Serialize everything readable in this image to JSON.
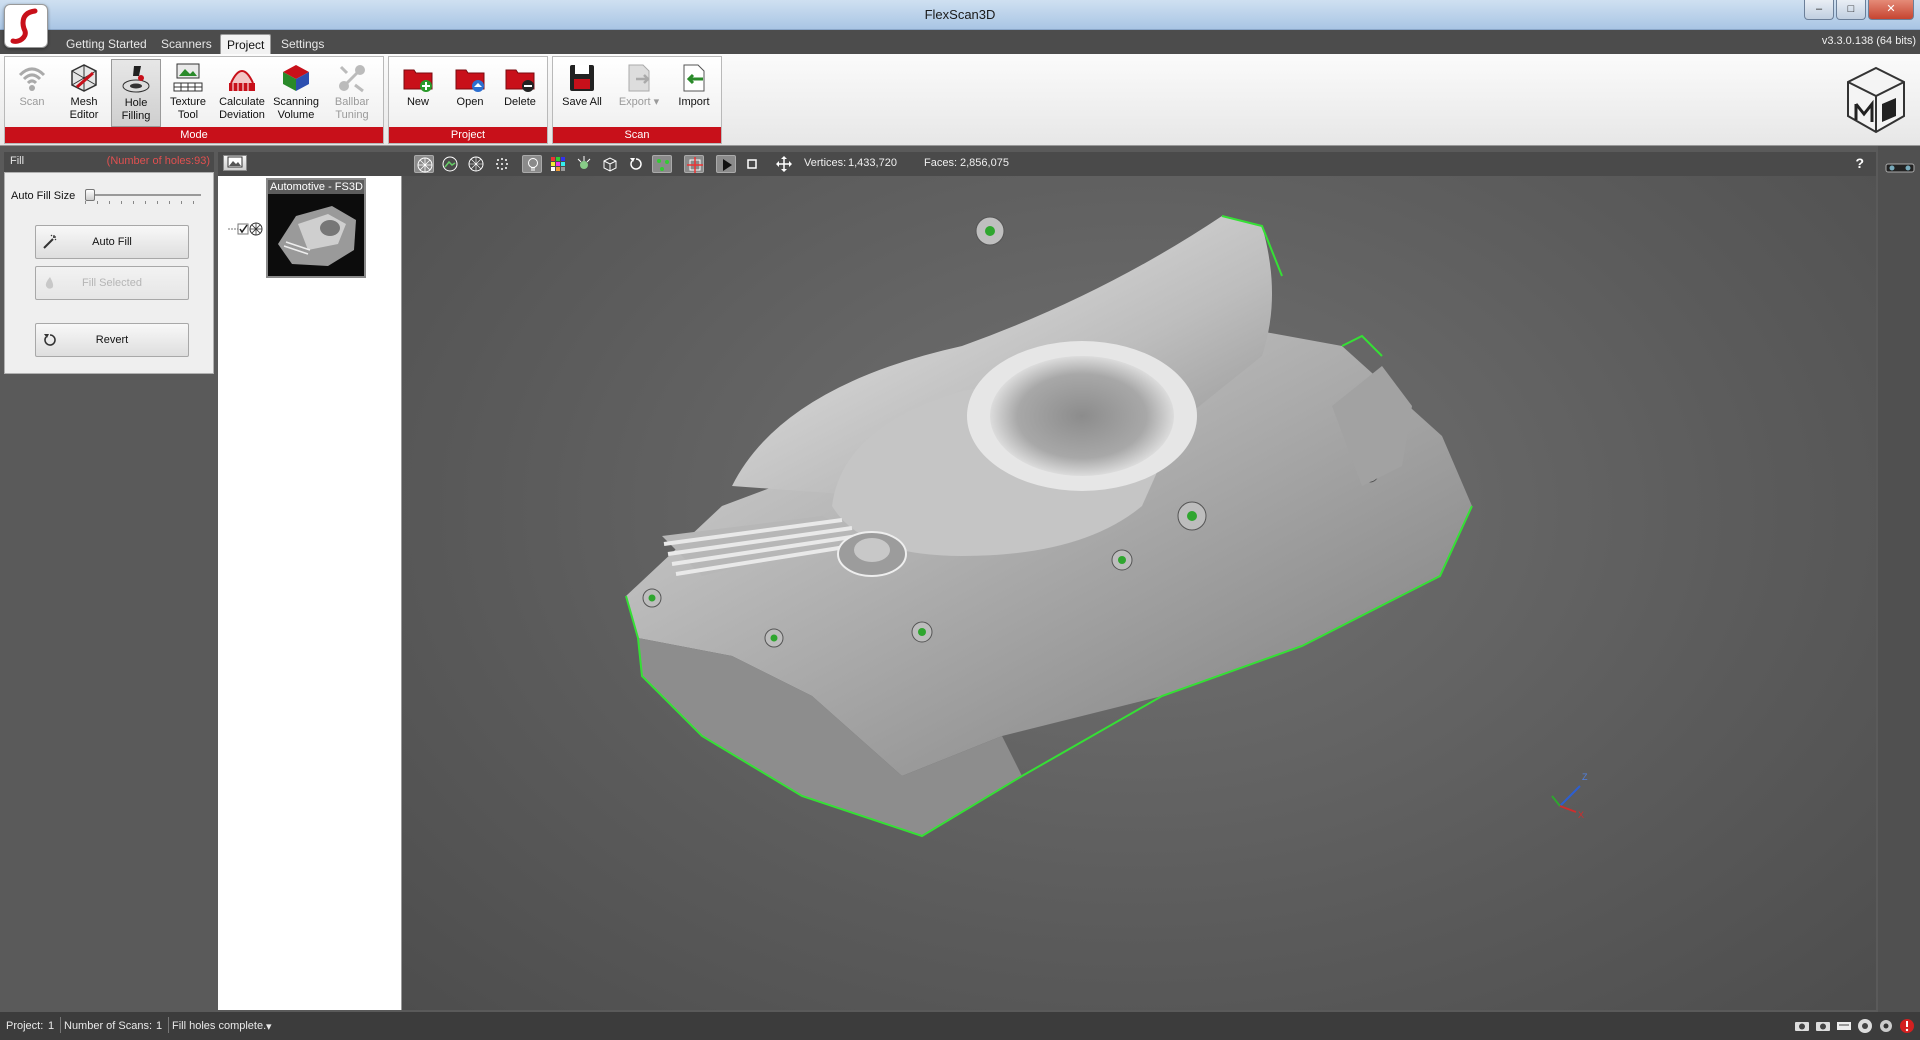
{
  "window": {
    "title": "FlexScan3D",
    "minimize": "–",
    "maximize": "□",
    "close": "✕"
  },
  "menu": {
    "tabs": [
      {
        "label": "Getting Started"
      },
      {
        "label": "Scanners"
      },
      {
        "label": "Project"
      },
      {
        "label": "Settings"
      }
    ],
    "active_tab": "Project",
    "version": "v3.3.0.138  (64 bits)"
  },
  "ribbon": {
    "mode": {
      "label": "Mode",
      "buttons": [
        {
          "label": "Scan",
          "icon": "wifi-scan-icon",
          "disabled": true
        },
        {
          "label": "Mesh Editor",
          "icon": "mesh-editor-icon"
        },
        {
          "label": "Hole Filling",
          "icon": "hole-filling-icon",
          "active": true
        },
        {
          "label": "Texture Tool",
          "icon": "texture-tool-icon"
        },
        {
          "label": "Calculate Deviation",
          "icon": "calculate-deviation-icon"
        },
        {
          "label": "Scanning Volume",
          "icon": "scanning-volume-icon"
        },
        {
          "label": "Ballbar Tuning",
          "icon": "ballbar-tuning-icon",
          "disabled": true
        }
      ]
    },
    "project": {
      "label": "Project",
      "buttons": [
        {
          "label": "New",
          "icon": "folder-new-icon"
        },
        {
          "label": "Open",
          "icon": "folder-open-icon"
        },
        {
          "label": "Delete",
          "icon": "folder-delete-icon"
        }
      ]
    },
    "scan": {
      "label": "Scan",
      "buttons": [
        {
          "label": "Save All",
          "icon": "save-icon"
        },
        {
          "label": "Export",
          "icon": "export-icon",
          "disabled": true
        },
        {
          "label": "Import",
          "icon": "import-icon"
        }
      ]
    },
    "accent": "#c8101a"
  },
  "fill_panel": {
    "title": "Fill",
    "holes": "(Number of holes:93)",
    "auto_fill_size_label": "Auto Fill Size",
    "auto_fill_size": 0,
    "auto_fill_button": "Auto Fill",
    "fill_selected_button": "Fill Selected",
    "revert_button": "Revert"
  },
  "scan_list": {
    "items": [
      {
        "name": "Automotive - FS3D",
        "checked": true
      }
    ]
  },
  "viewport_toolbar": {
    "vertices_label": "Vertices:",
    "vertices_value": "1,433,720",
    "faces_label": "Faces:",
    "faces_value": "2,856,075",
    "help": "?"
  },
  "status": {
    "project_label": "Project:",
    "project_value": "1",
    "scans_label": "Number of Scans:",
    "scans_value": "1",
    "message": "Fill holes complete."
  }
}
